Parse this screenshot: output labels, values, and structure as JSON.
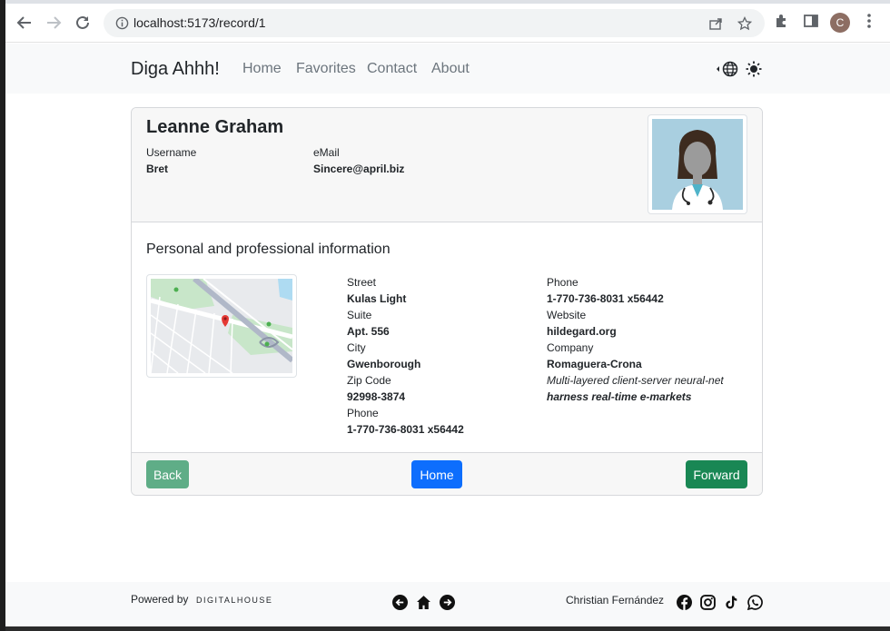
{
  "browser": {
    "url": "localhost:5173/record/1",
    "profile_initial": "C"
  },
  "navbar": {
    "brand": "Diga Ahhh!",
    "links": [
      "Home",
      "Favorites",
      "Contact",
      "About"
    ],
    "icons": [
      "globe-icon",
      "sun-icon"
    ]
  },
  "record": {
    "name": "Leanne Graham",
    "username_label": "Username",
    "username": "Bret",
    "email_label": "eMail",
    "email": "Sincere@april.biz",
    "section_title": "Personal and professional information",
    "address": {
      "street_label": "Street",
      "street": "Kulas Light",
      "suite_label": "Suite",
      "suite": "Apt. 556",
      "city_label": "City",
      "city": "Gwenborough",
      "zip_label": "Zip Code",
      "zip": "92998-3874",
      "phone_label": "Phone",
      "phone": "1-770-736-8031 x56442"
    },
    "professional": {
      "phone_label": "Phone",
      "phone": "1-770-736-8031 x56442",
      "website_label": "Website",
      "website": "hildegard.org",
      "company_label": "Company",
      "company": "Romaguera-Crona",
      "catch_phrase": "Multi-layered client-server neural-net",
      "bs": "harness real-time e-markets"
    }
  },
  "actions": {
    "back": "Back",
    "home": "Home",
    "forward": "Forward"
  },
  "footer": {
    "powered_by": "Powered by",
    "logo_text": "DIGITALHOUSE",
    "author": "Christian Fernández",
    "social": [
      "facebook-icon",
      "instagram-icon",
      "tiktok-icon",
      "whatsapp-icon"
    ]
  },
  "colors": {
    "back_button": "#5fad87",
    "home_button": "#0d6efd",
    "forward_button": "#198754"
  }
}
